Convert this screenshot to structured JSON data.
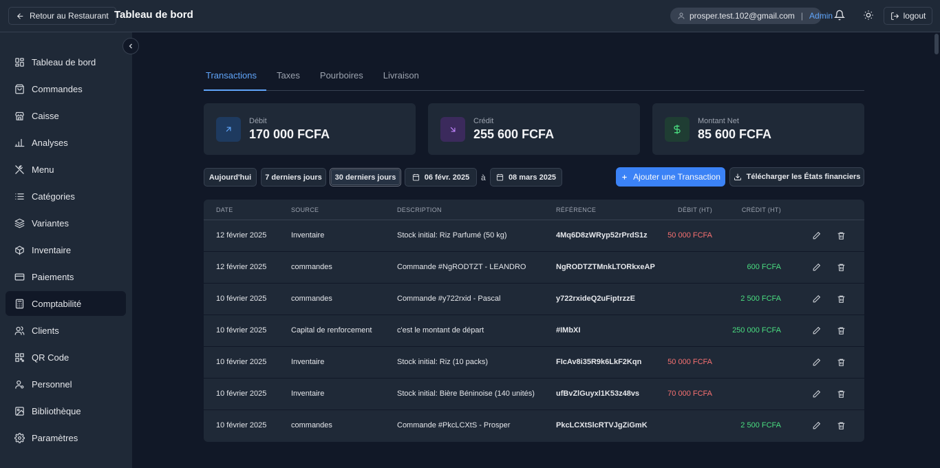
{
  "header": {
    "back_label": "Retour au Restaurant",
    "title": "Tableau de bord",
    "user_email": "prosper.test.102@gmail.com",
    "separator": "|",
    "user_role": "Admin",
    "logout_label": "logout"
  },
  "sidebar": {
    "items": [
      {
        "label": "Tableau de bord",
        "icon": "dashboard-icon"
      },
      {
        "label": "Commandes",
        "icon": "shopping-bag-icon"
      },
      {
        "label": "Caisse",
        "icon": "store-icon"
      },
      {
        "label": "Analyses",
        "icon": "bar-chart-icon"
      },
      {
        "label": "Menu",
        "icon": "utensils-icon"
      },
      {
        "label": "Catégories",
        "icon": "list-icon"
      },
      {
        "label": "Variantes",
        "icon": "layers-icon"
      },
      {
        "label": "Inventaire",
        "icon": "package-icon"
      },
      {
        "label": "Paiements",
        "icon": "credit-card-icon"
      },
      {
        "label": "Comptabilité",
        "icon": "calculator-icon"
      },
      {
        "label": "Clients",
        "icon": "users-icon"
      },
      {
        "label": "QR Code",
        "icon": "qr-code-icon"
      },
      {
        "label": "Personnel",
        "icon": "user-cog-icon"
      },
      {
        "label": "Bibliothèque",
        "icon": "image-icon"
      },
      {
        "label": "Paramètres",
        "icon": "settings-icon"
      }
    ],
    "active_index": 9
  },
  "tabs": [
    {
      "label": "Transactions",
      "active": true
    },
    {
      "label": "Taxes",
      "active": false
    },
    {
      "label": "Pourboires",
      "active": false
    },
    {
      "label": "Livraison",
      "active": false
    }
  ],
  "summary": {
    "debit": {
      "label": "Débit",
      "value": "170 000 FCFA",
      "color": "#60a5fa"
    },
    "credit": {
      "label": "Crédit",
      "value": "255 600 FCFA",
      "color": "#a855f7"
    },
    "net": {
      "label": "Montant Net",
      "value": "85 600 FCFA",
      "color": "#4ade80"
    }
  },
  "filters": {
    "today": "Aujourd'hui",
    "last7": "7 derniers jours",
    "last30": "30 derniers jours",
    "start_date": "06 févr. 2025",
    "to": "à",
    "end_date": "08 mars 2025",
    "add_label": "Ajouter une Transaction",
    "download_label": "Télécharger les États financiers"
  },
  "table": {
    "columns": [
      "DATE",
      "SOURCE",
      "DESCRIPTION",
      "RÉFÉRENCE",
      "DÉBIT (HT)",
      "CRÉDIT (HT)"
    ],
    "rows": [
      {
        "date": "12 février 2025",
        "source": "Inventaire",
        "description": "Stock initial: Riz Parfumé (50 kg)",
        "reference": "4Mq6D8zWRyp52rPrdS1z",
        "debit": "50 000 FCFA",
        "credit": ""
      },
      {
        "date": "12 février 2025",
        "source": "commandes",
        "description": "Commande #NgRODTZT - LEANDRO",
        "reference": "NgRODTZTMnkLTORkxeAP",
        "debit": "",
        "credit": "600 FCFA"
      },
      {
        "date": "10 février 2025",
        "source": "commandes",
        "description": "Commande #y722rxid - Pascal",
        "reference": "y722rxideQ2uFiptrzzE",
        "debit": "",
        "credit": "2 500 FCFA"
      },
      {
        "date": "10 février 2025",
        "source": "Capital de renforcement",
        "description": "c'est le montant de départ",
        "reference": "#IMbXI",
        "debit": "",
        "credit": "250 000 FCFA"
      },
      {
        "date": "10 février 2025",
        "source": "Inventaire",
        "description": "Stock initial: Riz (10 packs)",
        "reference": "FIcAv8i35R9k6LkF2Kqn",
        "debit": "50 000 FCFA",
        "credit": ""
      },
      {
        "date": "10 février 2025",
        "source": "Inventaire",
        "description": "Stock initial: Bière Béninoise (140 unités)",
        "reference": "ufBvZlGuyxl1K53z48vs",
        "debit": "70 000 FCFA",
        "credit": ""
      },
      {
        "date": "10 février 2025",
        "source": "commandes",
        "description": "Commande #PkcLCXtS - Prosper",
        "reference": "PkcLCXtSlcRTVJgZiGmK",
        "debit": "",
        "credit": "2 500 FCFA"
      }
    ]
  }
}
